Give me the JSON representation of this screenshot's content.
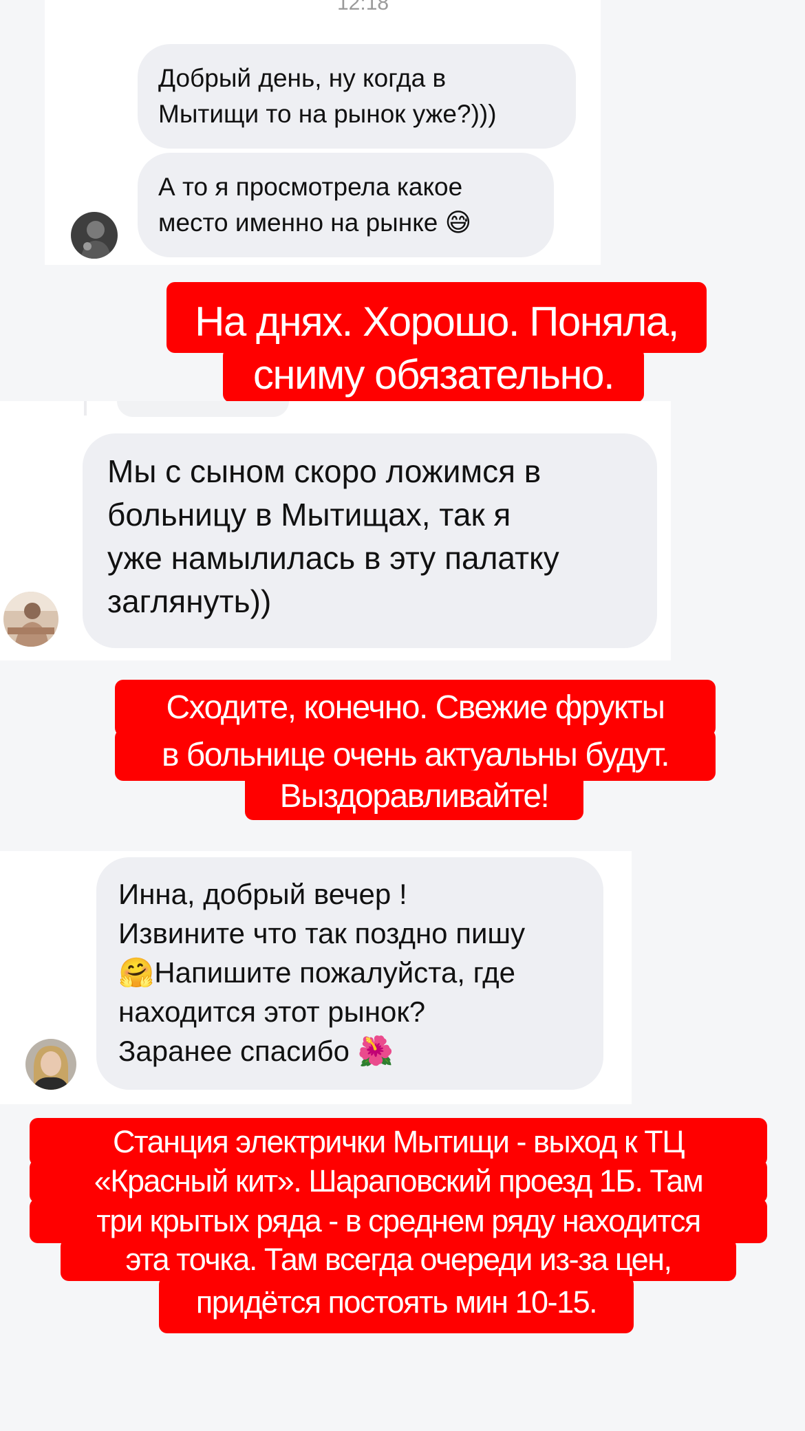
{
  "chat": {
    "timestamp": "12:18",
    "thread1": {
      "msg1": "Добрый день, ну когда в\nМытищи то на рынок уже?)))",
      "msg2": "А то я просмотрела какое\nместо именно на рынке 😅"
    },
    "reply1": {
      "line1": "На днях. Хорошо. Поняла,",
      "line2": "сниму обязательно."
    },
    "thread2": {
      "msg1": "Мы с сыном скоро ложимся в\nбольницу в Мытищах, так я\nуже намылилась в эту палатку\nзаглянуть))"
    },
    "reply2": {
      "line1": "Сходите, конечно. Свежие фрукты",
      "line2": "в больнице очень актуальны будут.",
      "line3": "Выздоравливайте!"
    },
    "thread3": {
      "msg1": "Инна, добрый вечер !\nИзвините что так поздно пишу\n🤗Напишите пожалуйста, где\nнаходится этот рынок?\nЗаранее спасибо 🌺"
    },
    "reply3": {
      "line1": "Станция электрички Мытищи - выход к ТЦ",
      "line2": "«Красный кит». Шараповский проезд 1Б. Там",
      "line3": "три крытых ряда - в среднем ряду находится",
      "line4": "эта точка. Там всегда очереди из-за цен,",
      "line5": "придётся постоять мин 10-15."
    }
  },
  "colors": {
    "page_bg": "#f5f6f8",
    "bubble_bg": "#eeeff3",
    "highlight_bg": "#ff0000",
    "highlight_text": "#ffffff"
  }
}
